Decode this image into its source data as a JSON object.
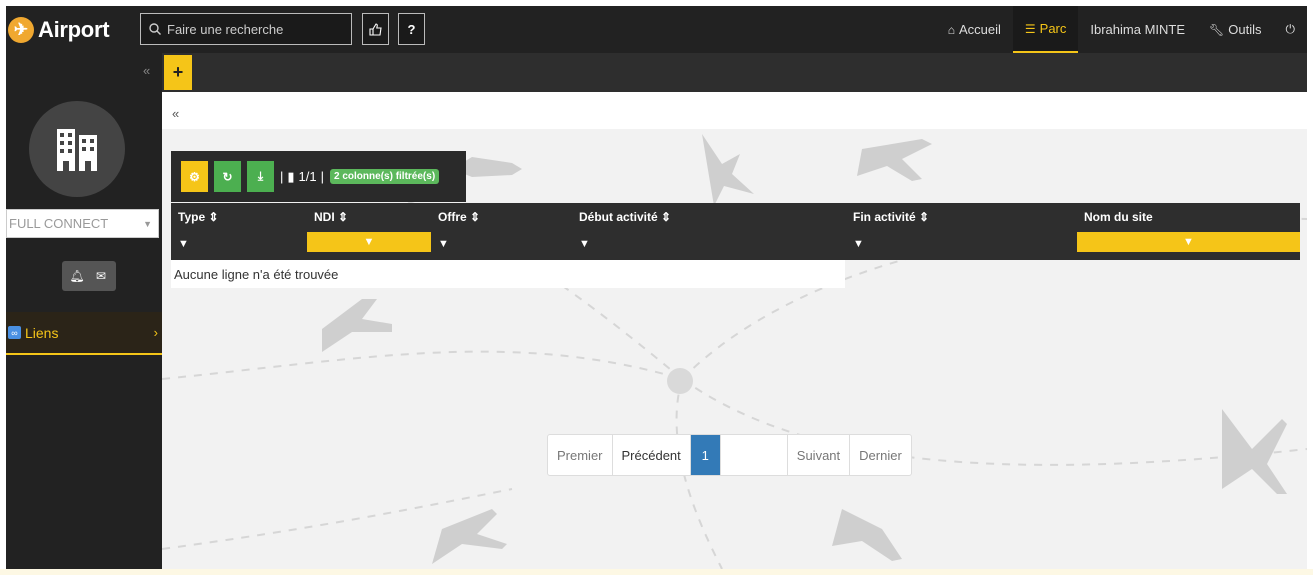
{
  "app": {
    "name": "Airport"
  },
  "search": {
    "placeholder": "Faire une recherche"
  },
  "topbar": {
    "help_label": "?",
    "nav": [
      {
        "label": "Accueil",
        "icon": "home-icon"
      },
      {
        "label": "Parc",
        "icon": "list-icon",
        "active": true
      },
      {
        "label": "Ibrahima MINTE",
        "icon": ""
      },
      {
        "label": "Outils",
        "icon": "wrench-icon"
      }
    ]
  },
  "sidebar": {
    "collapse": "«",
    "site_select": "FULL CONNECT",
    "menu": [
      {
        "label": "Liens",
        "icon": "link-icon"
      }
    ]
  },
  "tabs": {
    "add": "+"
  },
  "content": {
    "back": "«"
  },
  "toolbar": {
    "page_info": "1/1",
    "filter_badge": "2 colonne(s) filtrée(s)"
  },
  "table": {
    "columns": [
      "Type",
      "NDI",
      "Offre",
      "Début activité",
      "Fin activité",
      "Nom du site"
    ],
    "sortable_indicator": "≑",
    "filtered_columns": [
      "NDI",
      "Nom du site"
    ],
    "empty_message": "Aucune ligne n'a été trouvée"
  },
  "pagination": {
    "first": "Premier",
    "prev": "Précédent",
    "current": "1",
    "next": "Suivant",
    "last": "Dernier"
  },
  "colors": {
    "accent": "#f5c518",
    "dark": "#222222",
    "primary": "#337ab7",
    "success": "#4caf50"
  }
}
